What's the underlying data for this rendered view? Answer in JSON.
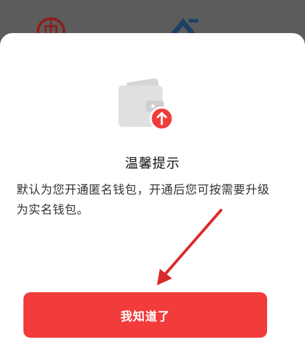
{
  "dialog": {
    "title": "温馨提示",
    "message": "默认为您开通匿名钱包，开通后您可按需要升级为实名钱包。",
    "confirm_label": "我知道了"
  },
  "icons": {
    "wallet": "wallet-upgrade-icon",
    "arrow": "upward-arrow-badge-icon"
  },
  "colors": {
    "accent": "#f23b3b",
    "wallet_gray": "#e0e0e0",
    "backdrop": "#5c5c5c",
    "annotation_arrow": "#d92b2b"
  }
}
